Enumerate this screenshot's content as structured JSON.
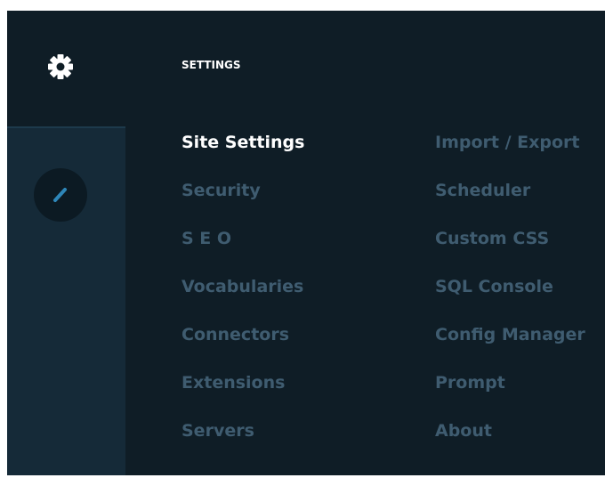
{
  "panel": {
    "title": "SETTINGS"
  },
  "rail": {
    "top_icon": "gear-icon",
    "items": [
      {
        "icon": "pencil-icon"
      }
    ]
  },
  "menu": {
    "left": [
      {
        "label": "Site Settings",
        "active": true
      },
      {
        "label": "Security"
      },
      {
        "label": "S E O"
      },
      {
        "label": "Vocabularies"
      },
      {
        "label": "Connectors"
      },
      {
        "label": "Extensions"
      },
      {
        "label": "Servers"
      }
    ],
    "right": [
      {
        "label": "Import / Export"
      },
      {
        "label": "Scheduler"
      },
      {
        "label": "Custom CSS"
      },
      {
        "label": "SQL Console"
      },
      {
        "label": "Config Manager"
      },
      {
        "label": "Prompt"
      },
      {
        "label": "About"
      }
    ]
  },
  "colors": {
    "background": "#0f1d26",
    "rail": "#152a38",
    "active_text": "#ffffff",
    "inactive_text": "#3f5c70"
  }
}
